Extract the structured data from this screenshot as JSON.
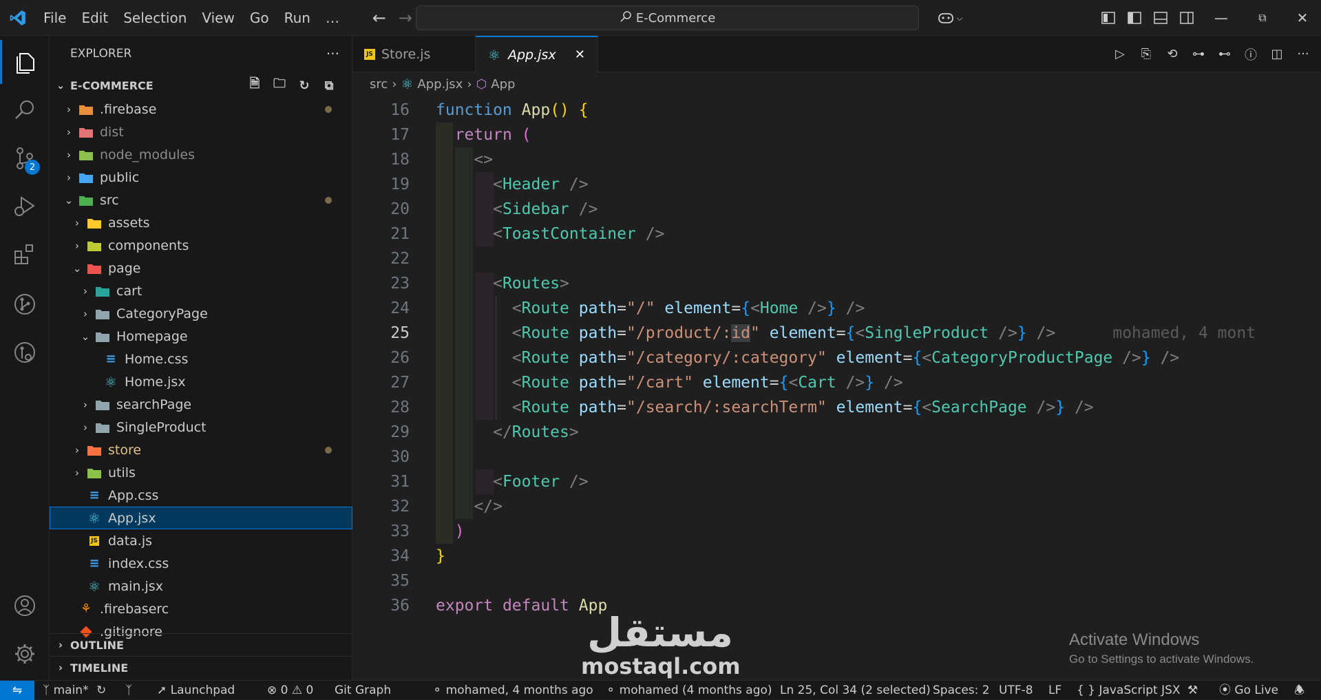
{
  "titlebar": {
    "menu": [
      "File",
      "Edit",
      "Selection",
      "View",
      "Go",
      "Run",
      "…"
    ],
    "search_text": "E-Commerce"
  },
  "explorer": {
    "title": "EXPLORER",
    "root": "E-COMMERCE",
    "items": [
      {
        "label": ".firebase",
        "depth": 0,
        "type": "folder",
        "expanded": false,
        "icon": "firebase-folder-icon",
        "color": "#e88d3a",
        "dot": true
      },
      {
        "label": "dist",
        "depth": 0,
        "type": "folder",
        "expanded": false,
        "icon": "dist-folder-icon",
        "color": "#e57373",
        "dim": true
      },
      {
        "label": "node_modules",
        "depth": 0,
        "type": "folder",
        "expanded": false,
        "icon": "node-folder-icon",
        "color": "#8bc34a",
        "dim": true
      },
      {
        "label": "public",
        "depth": 0,
        "type": "folder",
        "expanded": false,
        "icon": "public-folder-icon",
        "color": "#42a5f5"
      },
      {
        "label": "src",
        "depth": 0,
        "type": "folder",
        "expanded": true,
        "icon": "src-folder-icon",
        "color": "#4caf50",
        "dot": true
      },
      {
        "label": "assets",
        "depth": 1,
        "type": "folder",
        "expanded": false,
        "icon": "assets-folder-icon",
        "color": "#ffca28"
      },
      {
        "label": "components",
        "depth": 1,
        "type": "folder",
        "expanded": false,
        "icon": "components-folder-icon",
        "color": "#c0ca33"
      },
      {
        "label": "page",
        "depth": 1,
        "type": "folder",
        "expanded": true,
        "icon": "page-folder-icon",
        "color": "#ef5350"
      },
      {
        "label": "cart",
        "depth": 2,
        "type": "folder",
        "expanded": false,
        "icon": "cart-folder-icon",
        "color": "#26a69a"
      },
      {
        "label": "CategoryPage",
        "depth": 2,
        "type": "folder",
        "expanded": false,
        "icon": "folder-icon",
        "color": "#90a4ae"
      },
      {
        "label": "Homepage",
        "depth": 2,
        "type": "folder",
        "expanded": true,
        "icon": "folder-open-icon",
        "color": "#90a4ae"
      },
      {
        "label": "Home.css",
        "depth": 3,
        "type": "file",
        "icon": "css-file-icon",
        "color": "#42a5f5"
      },
      {
        "label": "Home.jsx",
        "depth": 3,
        "type": "file",
        "icon": "react-file-icon",
        "color": "#4dd0e1"
      },
      {
        "label": "searchPage",
        "depth": 2,
        "type": "folder",
        "expanded": false,
        "icon": "folder-icon",
        "color": "#90a4ae"
      },
      {
        "label": "SingleProduct",
        "depth": 2,
        "type": "folder",
        "expanded": false,
        "icon": "folder-icon",
        "color": "#90a4ae"
      },
      {
        "label": "store",
        "depth": 1,
        "type": "folder",
        "expanded": false,
        "icon": "store-folder-icon",
        "color": "#ff7043",
        "dot": true,
        "labelColor": "#e2c08d"
      },
      {
        "label": "utils",
        "depth": 1,
        "type": "folder",
        "expanded": false,
        "icon": "utils-folder-icon",
        "color": "#8bc34a"
      },
      {
        "label": "App.css",
        "depth": 1,
        "type": "file",
        "icon": "css-file-icon",
        "color": "#42a5f5"
      },
      {
        "label": "App.jsx",
        "depth": 1,
        "type": "file",
        "icon": "react-file-icon",
        "color": "#4dd0e1",
        "selected": true
      },
      {
        "label": "data.js",
        "depth": 1,
        "type": "file",
        "icon": "js-file-icon",
        "color": "#f0c419"
      },
      {
        "label": "index.css",
        "depth": 1,
        "type": "file",
        "icon": "css-file-icon",
        "color": "#42a5f5"
      },
      {
        "label": "main.jsx",
        "depth": 1,
        "type": "file",
        "icon": "react-file-icon",
        "color": "#4dd0e1"
      },
      {
        "label": ".firebaserc",
        "depth": 0,
        "type": "file",
        "icon": "firebase-file-icon",
        "color": "#ff8f00"
      },
      {
        "label": ".gitignore",
        "depth": 0,
        "type": "file",
        "icon": "git-file-icon",
        "color": "#f4511e"
      }
    ],
    "outline": "OUTLINE",
    "timeline": "TIMELINE"
  },
  "tabs": [
    {
      "label": "Store.js",
      "icon": "js-file-icon",
      "active": false
    },
    {
      "label": "App.jsx",
      "icon": "react-file-icon",
      "active": true
    }
  ],
  "breadcrumb": [
    "src",
    "App.jsx",
    "App"
  ],
  "editor": {
    "line_numbers": [
      "16",
      "17",
      "18",
      "19",
      "20",
      "21",
      "22",
      "23",
      "24",
      "25",
      "26",
      "27",
      "28",
      "29",
      "30",
      "31",
      "32",
      "33",
      "34",
      "35",
      "36"
    ],
    "current_line": "25",
    "blame": "mohamed, 4 mont"
  },
  "watermark": {
    "arabic": "مستقل",
    "latin": "mostaql.com"
  },
  "activation": {
    "title": "Activate Windows",
    "subtitle": "Go to Settings to activate Windows."
  },
  "status": {
    "branch": "main*",
    "launchpad": "Launchpad",
    "errors": "0",
    "warnings": "0",
    "git_graph": "Git Graph",
    "blame1": "mohamed, 4 months ago",
    "blame2": "mohamed (4 months ago)",
    "position": "Ln 25, Col 34 (2 selected)",
    "spaces": "Spaces: 2",
    "encoding": "UTF-8",
    "eol": "LF",
    "language": "JavaScript JSX",
    "golive": "Go Live"
  },
  "activity_badge": "2"
}
